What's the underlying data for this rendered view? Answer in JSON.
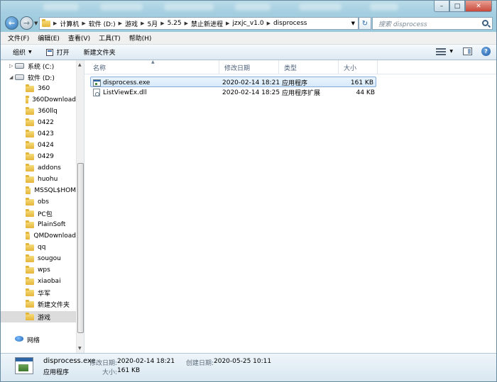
{
  "address_bar": {
    "crumbs": [
      "计算机",
      "软件 (D:)",
      "游戏",
      "5月",
      "5.25",
      "禁止新进程",
      "jzxjc_v1.0",
      "disprocess"
    ]
  },
  "search": {
    "placeholder": "搜索 disprocess"
  },
  "menu": [
    "文件(F)",
    "编辑(E)",
    "查看(V)",
    "工具(T)",
    "帮助(H)"
  ],
  "toolbar": {
    "organize": "组织",
    "open": "打开",
    "new_folder": "新建文件夹"
  },
  "nav": {
    "drives": [
      "系统 (C:)",
      "软件 (D:)"
    ],
    "folders": [
      "360",
      "360Download",
      "360llq",
      "0422",
      "0423",
      "0424",
      "0429",
      "addons",
      "huohu",
      "MSSQL$HOM",
      "obs",
      "PC包",
      "PlainSoft",
      "QMDownload",
      "qq",
      "sougou",
      "wps",
      "xiaobai",
      "华军",
      "新建文件夹",
      "游戏"
    ],
    "selected": "游戏",
    "network": "网络"
  },
  "columns": {
    "name": "名称",
    "modified": "修改日期",
    "type": "类型",
    "size": "大小"
  },
  "files": [
    {
      "name": "disprocess.exe",
      "modified": "2020-02-14 18:21",
      "type": "应用程序",
      "size": "161 KB",
      "icon": "exe-icon",
      "selected": true
    },
    {
      "name": "ListViewEx.dll",
      "modified": "2020-02-14 18:25",
      "type": "应用程序扩展",
      "size": "44 KB",
      "icon": "dll-icon",
      "selected": false
    }
  ],
  "details": {
    "name": "disprocess.exe",
    "kind": "应用程序",
    "modified_label": "修改日期:",
    "modified": "2020-02-14 18:21",
    "created_label": "创建日期:",
    "created": "2020-05-25 10:11",
    "size_label": "大小:",
    "size": "161 KB"
  },
  "colors": {
    "selection": "#d7eaf9",
    "selection_border": "#84acd6",
    "column_text": "#4c607a"
  }
}
